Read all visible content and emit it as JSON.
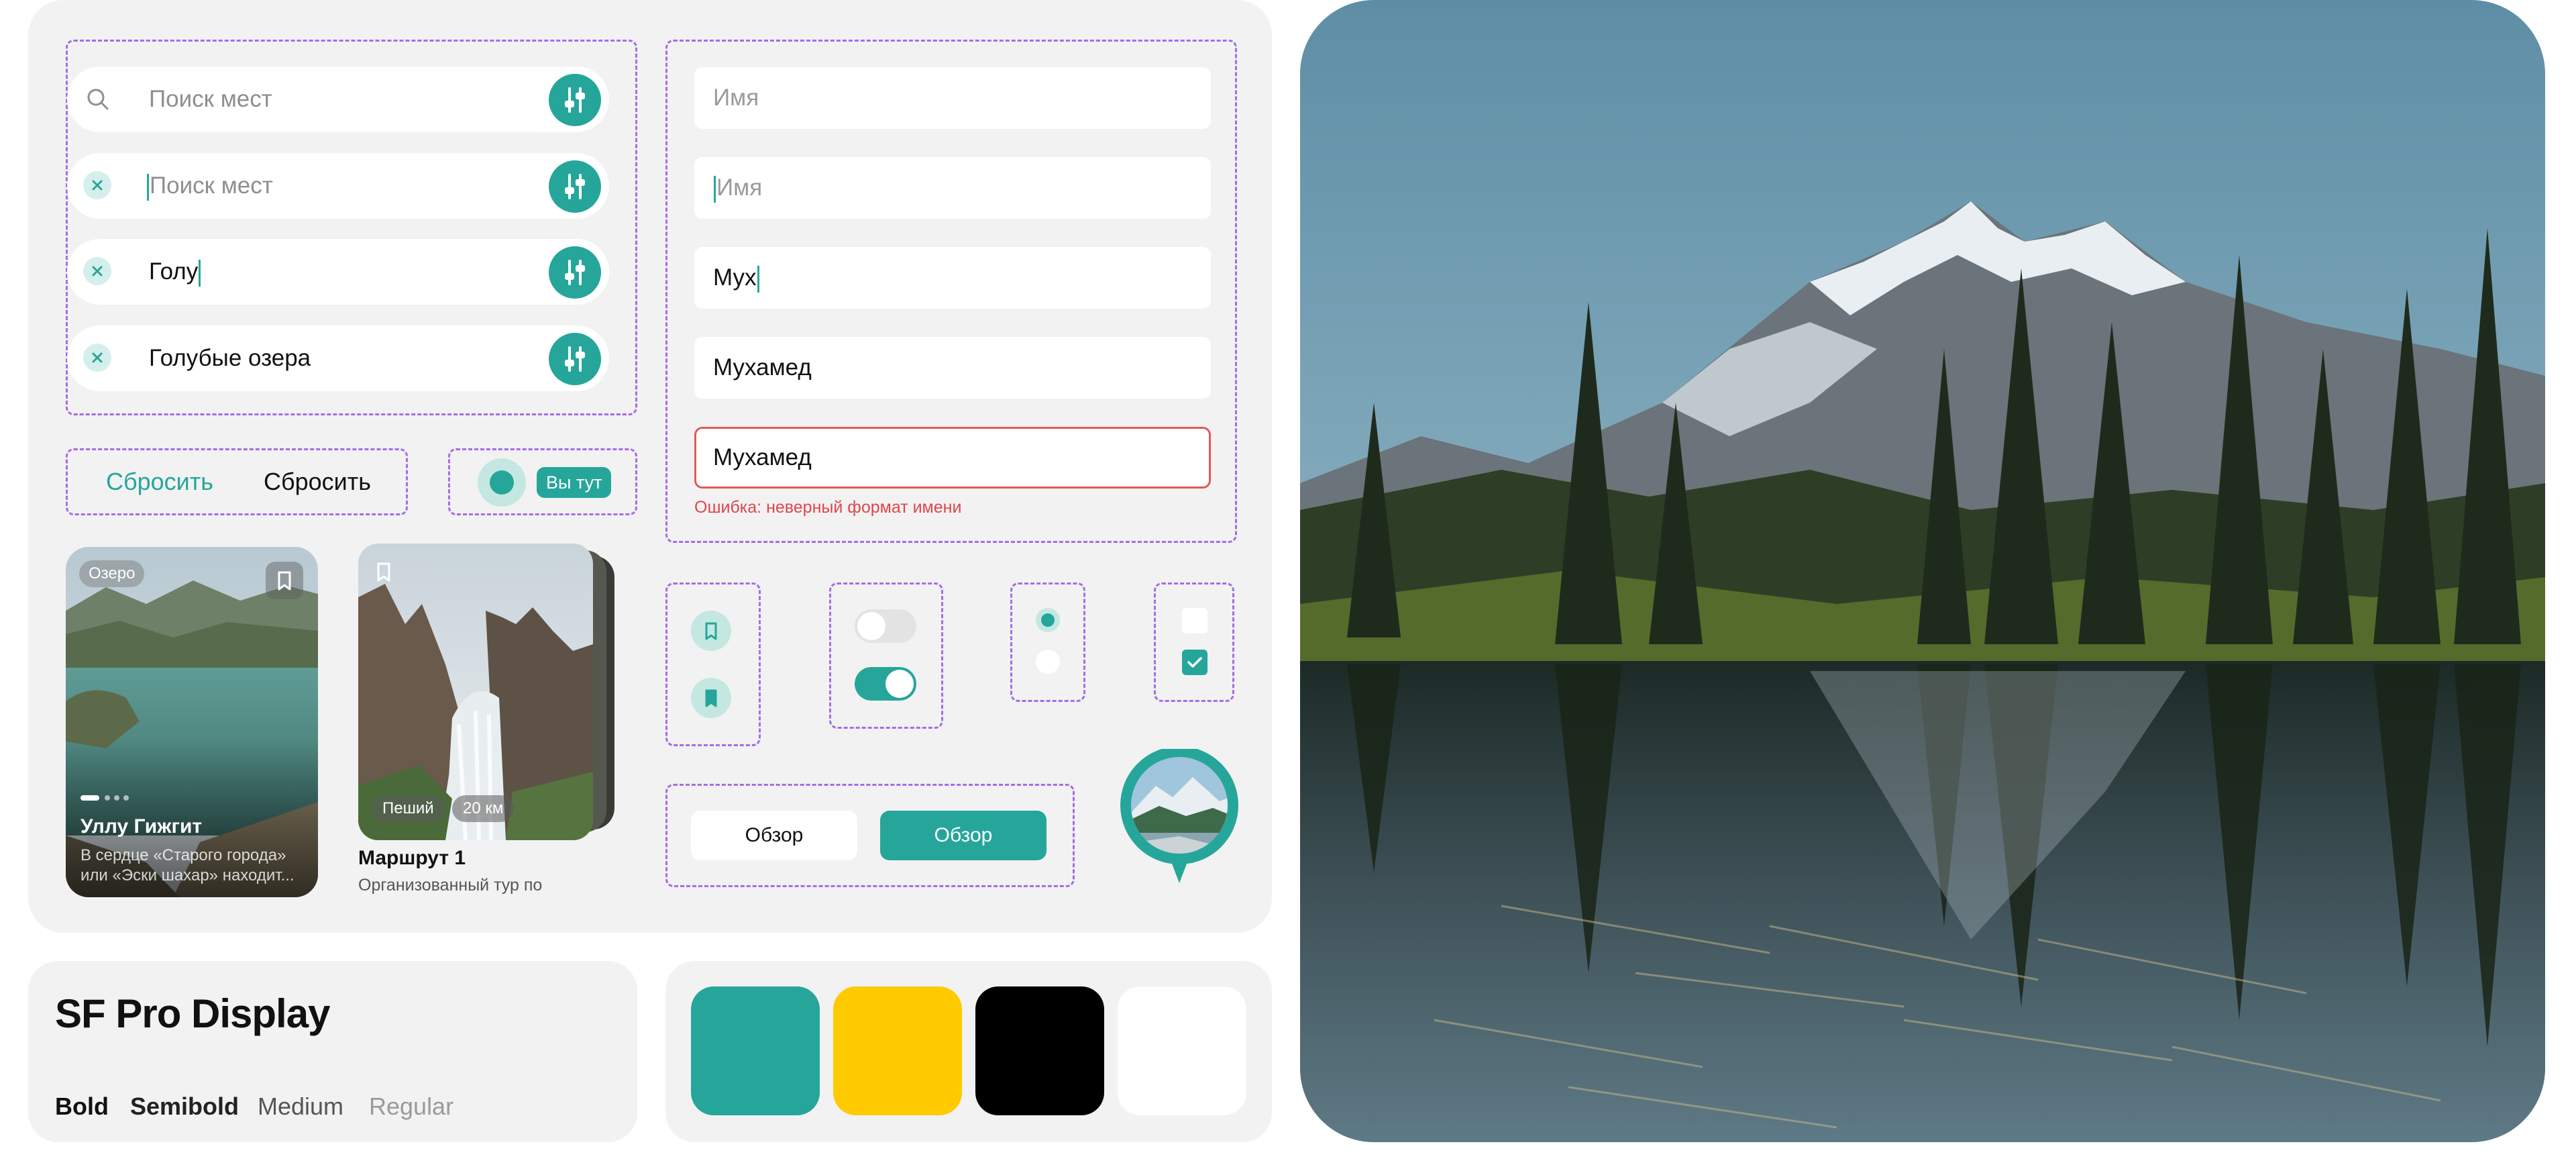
{
  "search": {
    "placeholder": "Поиск мест",
    "typed_partial": "Голу",
    "typed_full": "Голубые озера"
  },
  "name_field": {
    "placeholder": "Имя",
    "typed_partial": "Мух",
    "typed_full": "Мухамед",
    "error_value": "Мухамед",
    "error_message": "Ошибка: неверный формат имени"
  },
  "reset": {
    "label_accent": "Сбросить",
    "label_dark": "Сбросить"
  },
  "location_pin": {
    "label": "Вы тут"
  },
  "card_lake": {
    "badge": "Озеро",
    "title": "Уллу Гижгит",
    "description": "В сердце «Старого города» или «Эски шахар» находит..."
  },
  "card_route": {
    "tag_type": "Пеший",
    "tag_distance": "20 км",
    "title": "Маршрут 1",
    "subtitle": "Организованный тур по"
  },
  "overview": {
    "label_outline": "Обзор",
    "label_filled": "Обзор"
  },
  "controls": {
    "toggle_off": false,
    "toggle_on": true,
    "radio_selected_index": 0,
    "checkbox_checked": [
      false,
      true
    ]
  },
  "typography": {
    "family": "SF Pro Display",
    "weights": [
      "Bold",
      "Semibold",
      "Medium",
      "Regular"
    ]
  },
  "palette": {
    "teal": "#26A69A",
    "yellow": "#FFCA00",
    "black": "#000000",
    "white": "#FFFFFF"
  }
}
